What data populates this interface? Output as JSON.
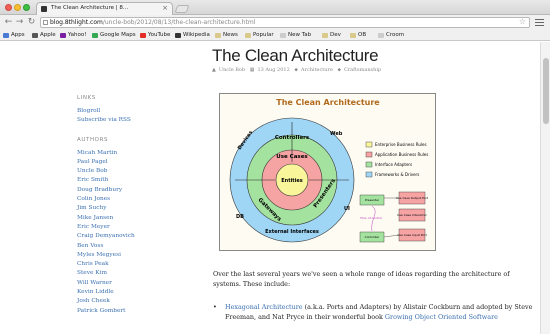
{
  "tab": {
    "title": "The Clean Architecture | 8..."
  },
  "toolbar": {
    "back": "←",
    "forward": "→",
    "reload": "↻",
    "url_host": "blog.8thlight.com",
    "url_path": "/uncle-bob/2012/08/13/the-clean-architecture.html",
    "star": "☆"
  },
  "bookmarks": [
    {
      "label": "Apps",
      "color": "#4a7bd4"
    },
    {
      "label": "Apple",
      "color": "#555555"
    },
    {
      "label": "Yahoo!",
      "color": "#7b1fa2"
    },
    {
      "label": "Google Maps",
      "color": "#34a853"
    },
    {
      "label": "YouTube",
      "color": "#e52d27"
    },
    {
      "label": "Wikipedia",
      "color": "#333333"
    },
    {
      "label": "News",
      "color": "#d9c98a"
    },
    {
      "label": "Popular",
      "color": "#d9c98a"
    },
    {
      "label": "New Tab",
      "color": "#cccccc"
    },
    {
      "label": "Dev",
      "color": "#d9c98a"
    },
    {
      "label": "OB",
      "color": "#d9c98a"
    },
    {
      "label": "Croom",
      "color": "#cccccc"
    }
  ],
  "sidebar": {
    "links_title": "LINKS",
    "links": [
      "Blogroll",
      "Subscribe via RSS"
    ],
    "authors_title": "AUTHORS",
    "authors": [
      "Micah Martin",
      "Paul Pagel",
      "Uncle Bob",
      "Eric Smith",
      "Doug Bradbury",
      "Colin Jones",
      "Jim Suchy",
      "Mike Jansen",
      "Eric Meyer",
      "Craig Demyanovich",
      "Ben Voss",
      "Myles Megyesi",
      "Chris Peak",
      "Steve Kim",
      "Will Warner",
      "Kevin Liddle",
      "Josh Cheek",
      "Patrick Gombert"
    ]
  },
  "post": {
    "title": "The Clean Architecture",
    "author": "Uncle Bob",
    "date": "13 Aug 2012",
    "tags": [
      "Architecture",
      "Craftsmanship"
    ],
    "intro": "Over the last several years we've seen a whole range of ideas regarding the architecture of systems. These include:",
    "bullet_link": "Hexagonal Architecture",
    "bullet_text": " (a.k.a. Ports and Adapters) by Alistair Cockburn and adopted by Steve Freeman, and Nat Pryce in their wonderful book ",
    "bullet_link2": "Growing Object Oriented Software"
  },
  "diagram": {
    "title": "The Clean Architecture",
    "rings": [
      "Web",
      "Devices",
      "Controllers",
      "Use Cases",
      "Entities",
      "Gateways",
      "Presenters",
      "DB",
      "UI",
      "External Interfaces"
    ],
    "legend": [
      "Enterprise Business Rules",
      "Application Business Rules",
      "Interface Adapters",
      "Frameworks & Drivers"
    ],
    "flow": [
      "Presenter",
      "Use Case Output Port",
      "Use Case Interactor",
      "Controller",
      "Use Case Input Port",
      "Flow of control"
    ],
    "colors": {
      "outer": "#9fd5f5",
      "adapters": "#a4e39f",
      "usecases": "#f6a3a3",
      "entities": "#f8f59a",
      "title": "#b26a1e"
    }
  }
}
